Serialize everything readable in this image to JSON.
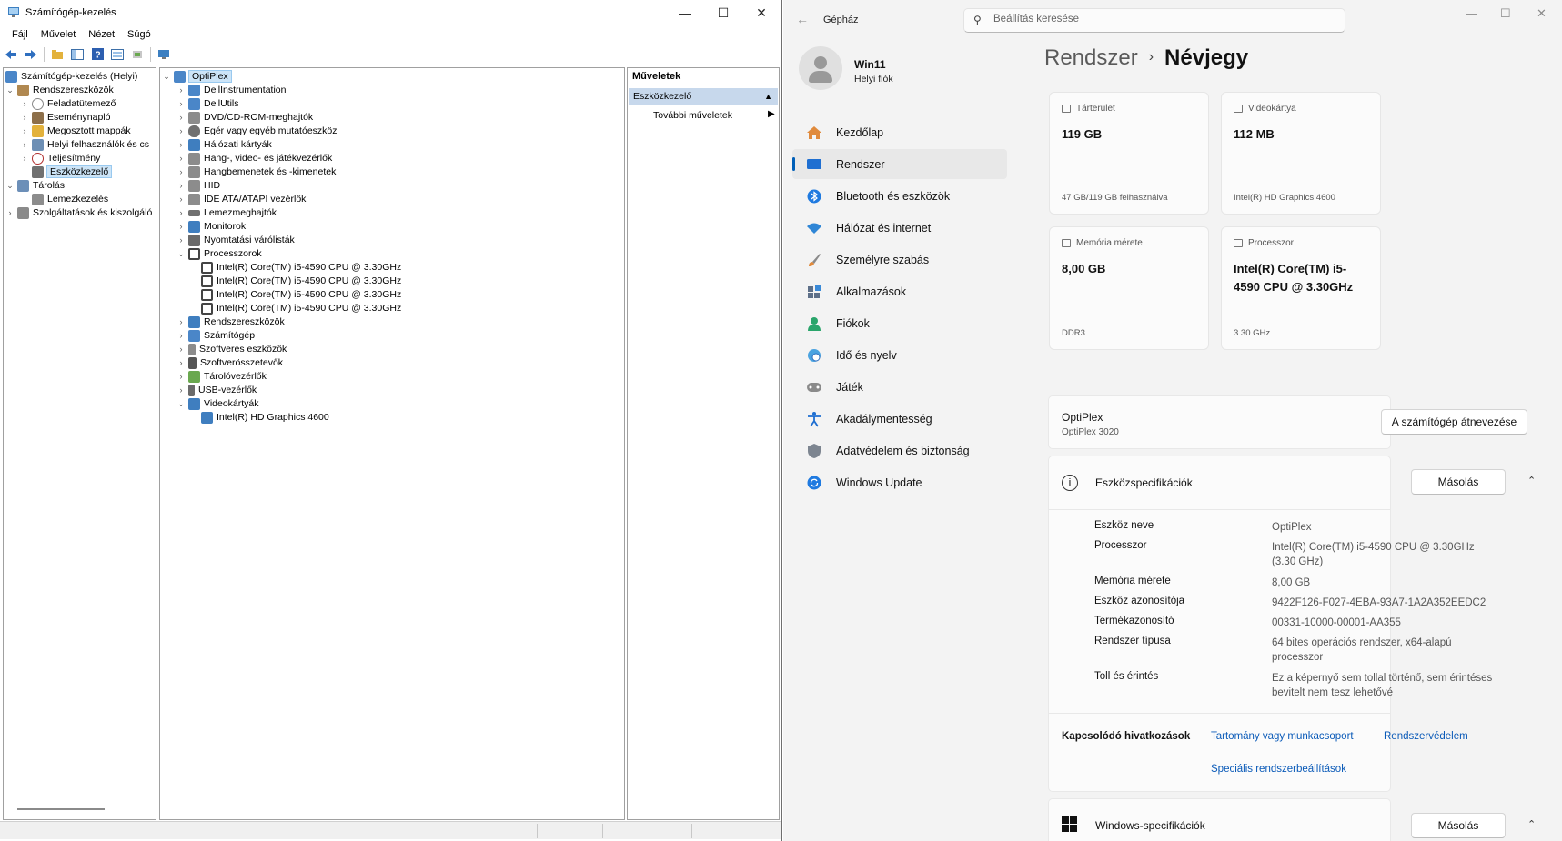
{
  "mmc": {
    "title": "Számítógép-kezelés",
    "window_buttons": {
      "minimize": "—",
      "maximize": "☐",
      "close": "✕"
    },
    "menu": [
      "Fájl",
      "Művelet",
      "Nézet",
      "Súgó"
    ],
    "tree": [
      "Számítógép-kezelés (Helyi)",
      "Rendszereszközök",
      "Feladatütemező",
      "Eseménynapló",
      "Megosztott mappák",
      "Helyi felhasználók és cs",
      "Teljesítmény",
      "Eszközkezelő",
      "Tárolás",
      "Lemezkezelés",
      "Szolgáltatások és kiszolgáló"
    ],
    "devices": {
      "root": "OptiPlex",
      "items": [
        "DellInstrumentation",
        "DellUtils",
        "DVD/CD-ROM-meghajtók",
        "Egér vagy egyéb mutatóeszköz",
        "Hálózati kártyák",
        "Hang-, video- és játékvezérlők",
        "Hangbemenetek és -kimenetek",
        "HID",
        "IDE ATA/ATAPI vezérlők",
        "Lemezmeghajtók",
        "Monitorok",
        "Nyomtatási várólisták",
        "Processzorok",
        "Intel(R) Core(TM) i5-4590 CPU @ 3.30GHz",
        "Intel(R) Core(TM) i5-4590 CPU @ 3.30GHz",
        "Intel(R) Core(TM) i5-4590 CPU @ 3.30GHz",
        "Intel(R) Core(TM) i5-4590 CPU @ 3.30GHz",
        "Rendszereszközök",
        "Számítógép",
        "Szoftveres eszközök",
        "Szoftverösszetevők",
        "Tárolóvezérlők",
        "USB-vezérlők",
        "Videokártyák",
        "Intel(R) HD Graphics 4600"
      ]
    },
    "actions": {
      "header": "Műveletek",
      "section": "Eszközkezelő",
      "more": "További műveletek"
    }
  },
  "settings": {
    "app_title": "Gépház",
    "search_placeholder": "Beállítás keresése",
    "account": {
      "name": "Win11",
      "type": "Helyi fiók"
    },
    "nav": [
      "Kezdőlap",
      "Rendszer",
      "Bluetooth és eszközök",
      "Hálózat és internet",
      "Személyre szabás",
      "Alkalmazások",
      "Fiókok",
      "Idő és nyelv",
      "Játék",
      "Akadálymentesség",
      "Adatvédelem és biztonság",
      "Windows Update"
    ],
    "breadcrumb": {
      "parent": "Rendszer",
      "current": "Névjegy"
    },
    "cards": {
      "storage": {
        "label": "Tárterület",
        "value": "119 GB",
        "foot": "47 GB/119 GB felhasználva"
      },
      "gpu": {
        "label": "Videokártya",
        "value": "112 MB",
        "foot": "Intel(R) HD Graphics 4600"
      },
      "memory": {
        "label": "Memória mérete",
        "value": "8,00 GB",
        "foot": "DDR3"
      },
      "cpu": {
        "label": "Processzor",
        "value": "Intel(R) Core(TM) i5-4590 CPU @ 3.30GHz",
        "foot": "3.30 GHz"
      }
    },
    "device": {
      "name": "OptiPlex",
      "model": "OptiPlex 3020",
      "rename": "A számítógép átnevezése"
    },
    "specs": {
      "title": "Eszközspecifikációk",
      "copy": "Másolás",
      "rows": [
        {
          "k": "Eszköz neve",
          "v": "OptiPlex"
        },
        {
          "k": "Processzor",
          "v": "Intel(R) Core(TM) i5-4590 CPU @ 3.30GHz (3.30 GHz)"
        },
        {
          "k": "Memória mérete",
          "v": "8,00 GB"
        },
        {
          "k": "Eszköz azonosítója",
          "v": "9422F126-F027-4EBA-93A7-1A2A352EEDC2"
        },
        {
          "k": "Termékazonosító",
          "v": "00331-10000-00001-AA355"
        },
        {
          "k": "Rendszer típusa",
          "v": "64 bites operációs rendszer, x64-alapú processzor"
        },
        {
          "k": "Toll és érintés",
          "v": "Ez a képernyő sem tollal történő, sem érintéses bevitelt nem tesz lehetővé"
        }
      ]
    },
    "related": {
      "label": "Kapcsolódó hivatkozások",
      "links": [
        "Tartomány vagy munkacsoport",
        "Rendszervédelem",
        "Speciális rendszerbeállítások"
      ]
    },
    "windows_specs": {
      "title": "Windows-specifikációk",
      "copy": "Másolás"
    }
  }
}
